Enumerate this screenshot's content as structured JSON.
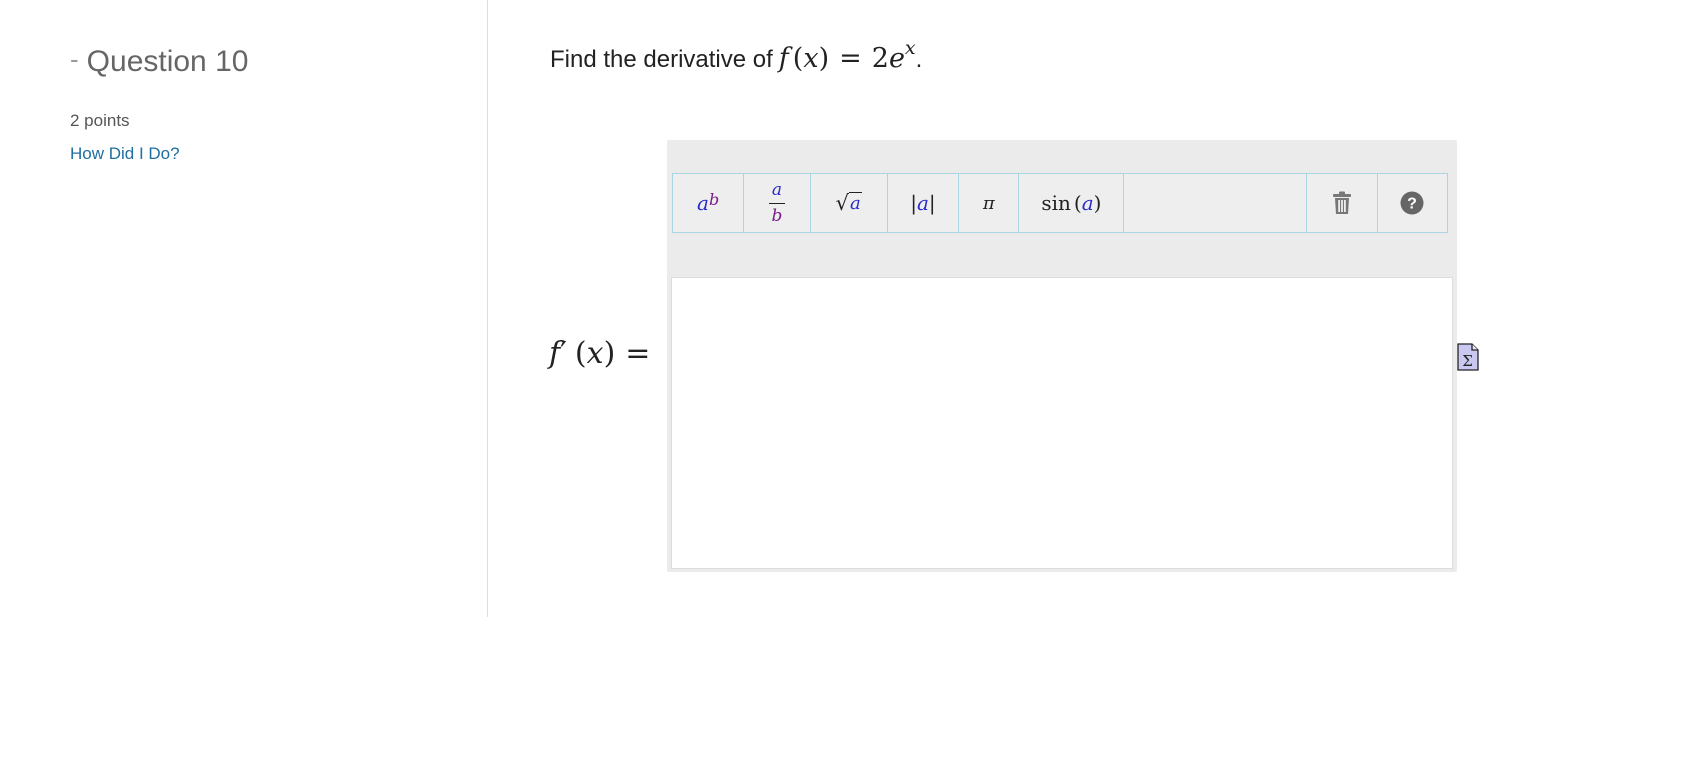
{
  "sidebar": {
    "collapse_symbol": "-",
    "question_title": "Question 10",
    "points": "2 points",
    "feedback_link": "How Did I Do?"
  },
  "prompt": {
    "text": "Find the derivative of",
    "func": "f",
    "open_paren": "(",
    "var": "x",
    "close_paren": ")",
    "equals": "=",
    "coefficient": "2",
    "base": "e",
    "exponent": "x",
    "period": "."
  },
  "answer_label": {
    "func": "f",
    "prime": "′",
    "open_paren": "(",
    "var": "x",
    "close_paren": ")",
    "equals": "="
  },
  "toolbar": {
    "power": {
      "base": "a",
      "exponent": "b"
    },
    "fraction": {
      "numerator": "a",
      "denominator": "b"
    },
    "sqrt": {
      "radical": "√",
      "radicand": "a"
    },
    "abs": {
      "left": "|",
      "value": "a",
      "right": "|"
    },
    "pi": {
      "symbol": "π"
    },
    "sin": {
      "name": "sin",
      "open": "(",
      "arg": "a",
      "close": ")"
    },
    "trash_icon": "trash-icon",
    "help_icon": "help-circle-icon"
  },
  "editor": {
    "value": ""
  },
  "equation_editor_icon": "sigma-document-icon",
  "colors": {
    "link": "#1f6fa0",
    "variable": "#2b2bc9",
    "exponent": "#7a1a8a",
    "toolbar_border": "#a9d6e2",
    "editor_bg": "#ebebeb"
  }
}
